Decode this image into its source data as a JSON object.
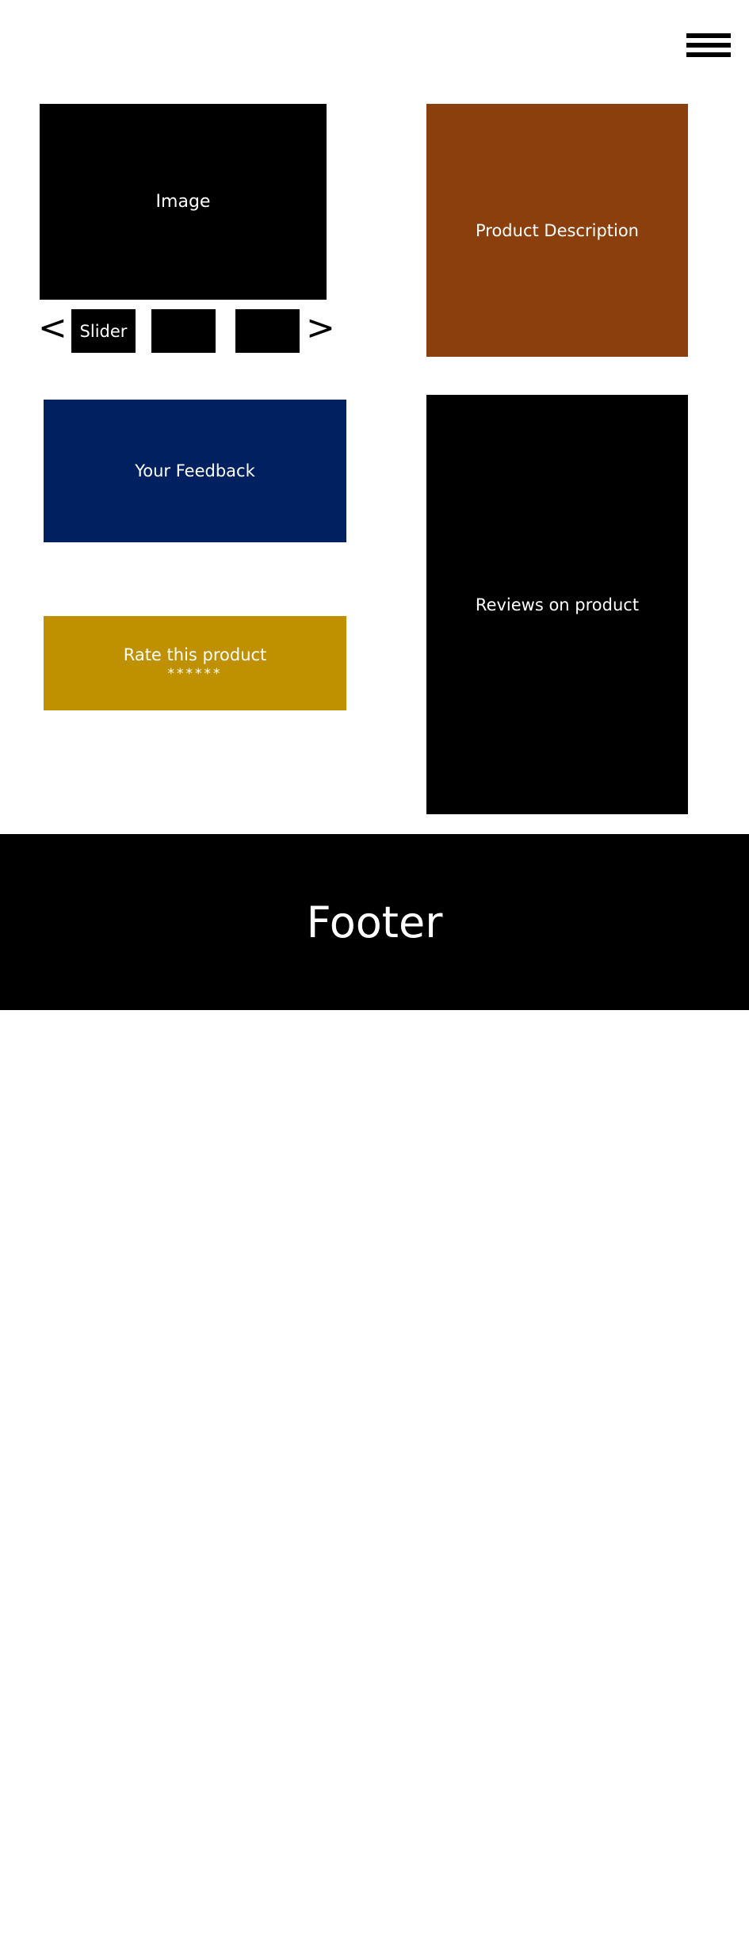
{
  "header": {
    "menu_icon": "hamburger-menu-icon"
  },
  "gallery": {
    "image_label": "Image",
    "prev_arrow": "<",
    "next_arrow": ">",
    "slider_label": "Slider"
  },
  "product": {
    "description_label": "Product Description"
  },
  "feedback": {
    "label": "Your Feedback"
  },
  "rating": {
    "label": "Rate this product",
    "stars": "******"
  },
  "reviews": {
    "label": "Reviews on product"
  },
  "footer": {
    "label": "Footer"
  },
  "colors": {
    "black": "#000000",
    "description_bg": "#8B3F0C",
    "feedback_bg": "#00205F",
    "rating_bg": "#BF9000",
    "text_on_dark": "#FFFFFF"
  }
}
